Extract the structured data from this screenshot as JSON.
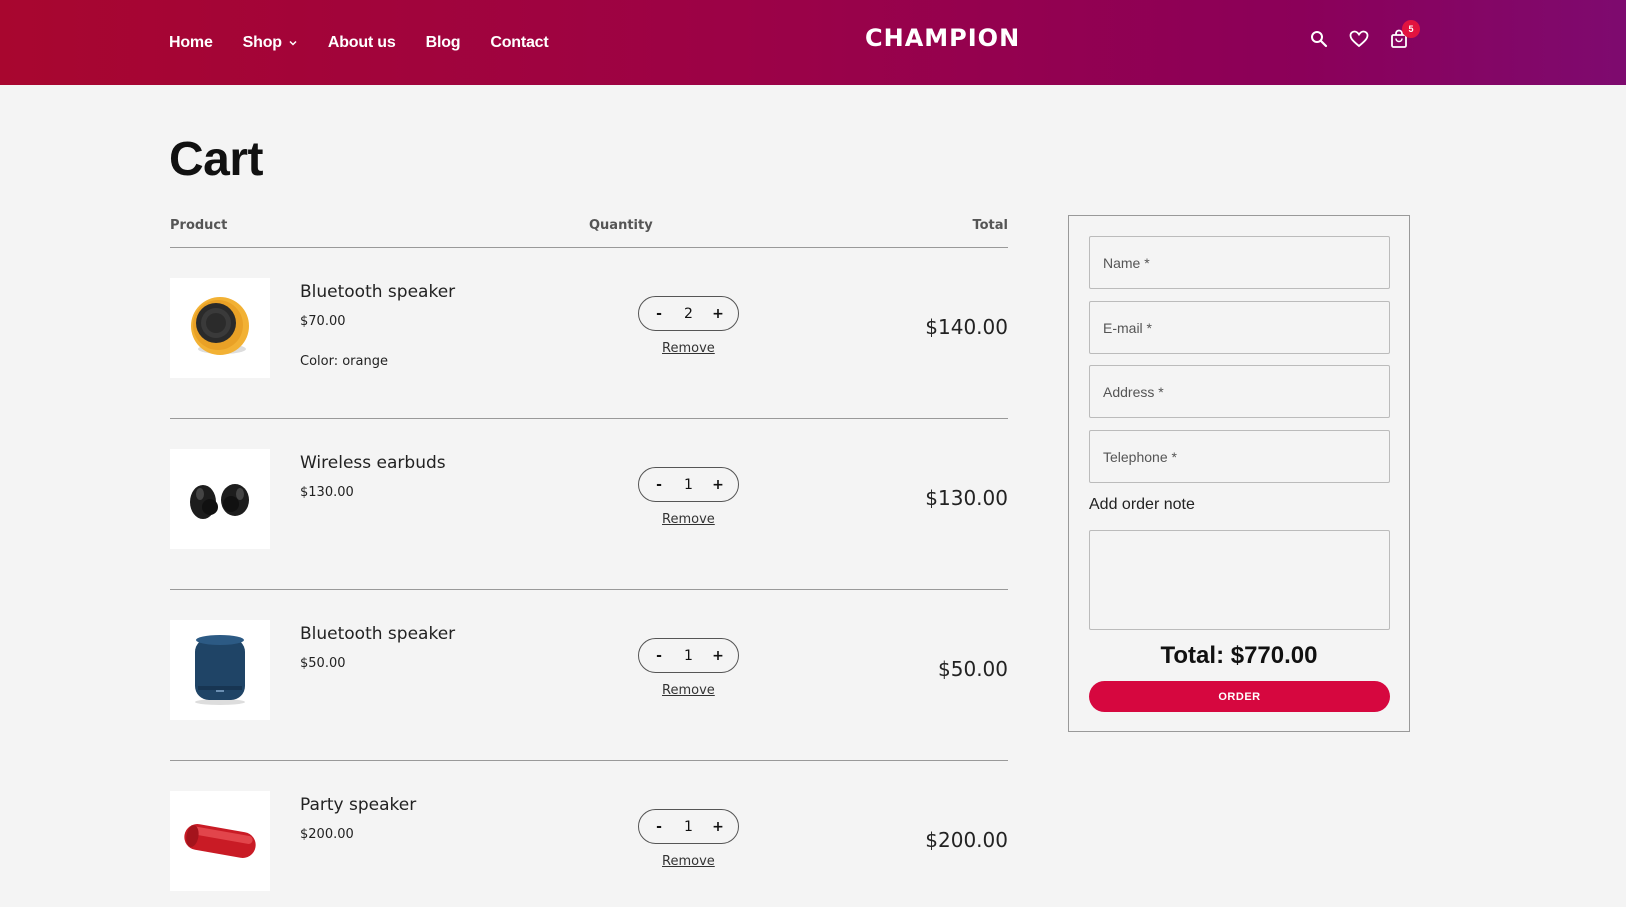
{
  "header": {
    "nav": [
      {
        "label": "Home"
      },
      {
        "label": "Shop"
      },
      {
        "label": "About us"
      },
      {
        "label": "Blog"
      },
      {
        "label": "Contact"
      }
    ],
    "logo": "CHAMPION",
    "cart_count": "5",
    "icons": [
      "search-icon",
      "heart-icon",
      "bag-icon"
    ]
  },
  "page": {
    "title": "Cart"
  },
  "table": {
    "headers": {
      "product": "Product",
      "quantity": "Quantity",
      "total": "Total"
    },
    "items": [
      {
        "name": "Bluetooth speaker",
        "price": "$70.00",
        "color": "Color: orange",
        "qty": "2",
        "remove": "Remove",
        "total": "$140.00"
      },
      {
        "name": "Wireless earbuds",
        "price": "$130.00",
        "color": "",
        "qty": "1",
        "remove": "Remove",
        "total": "$130.00"
      },
      {
        "name": "Bluetooth speaker",
        "price": "$50.00",
        "color": "",
        "qty": "1",
        "remove": "Remove",
        "total": "$50.00"
      },
      {
        "name": "Party speaker",
        "price": "$200.00",
        "color": "",
        "qty": "1",
        "remove": "Remove",
        "total": "$200.00"
      }
    ],
    "stepper": {
      "minus": "-",
      "plus": "+"
    }
  },
  "order": {
    "name_placeholder": "Name *",
    "email_placeholder": "E-mail *",
    "address_placeholder": "Address *",
    "phone_placeholder": "Telephone *",
    "note_label": "Add order note",
    "total": "Total: $770.00",
    "button": "ORDER"
  },
  "colors": {
    "header_start": "#a8062f",
    "header_end": "#7e0a6f",
    "accent": "#d6073f"
  }
}
